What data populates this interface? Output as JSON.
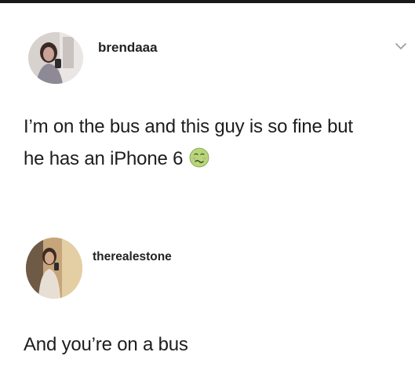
{
  "posts": [
    {
      "username": "brendaaa",
      "text_line_1": "I’m on the bus and this guy is so fine but",
      "text_line_2": "he has an iPhone 6",
      "emoji": "nauseated-face-icon",
      "has_menu_chevron": true
    },
    {
      "username": "therealestone",
      "text_line_1": "And you’re on a bus"
    }
  ],
  "colors": {
    "text": "#1d1d1d",
    "username": "#222222",
    "chevron": "#9a9a9a",
    "emoji_face": "#b7d67a"
  }
}
